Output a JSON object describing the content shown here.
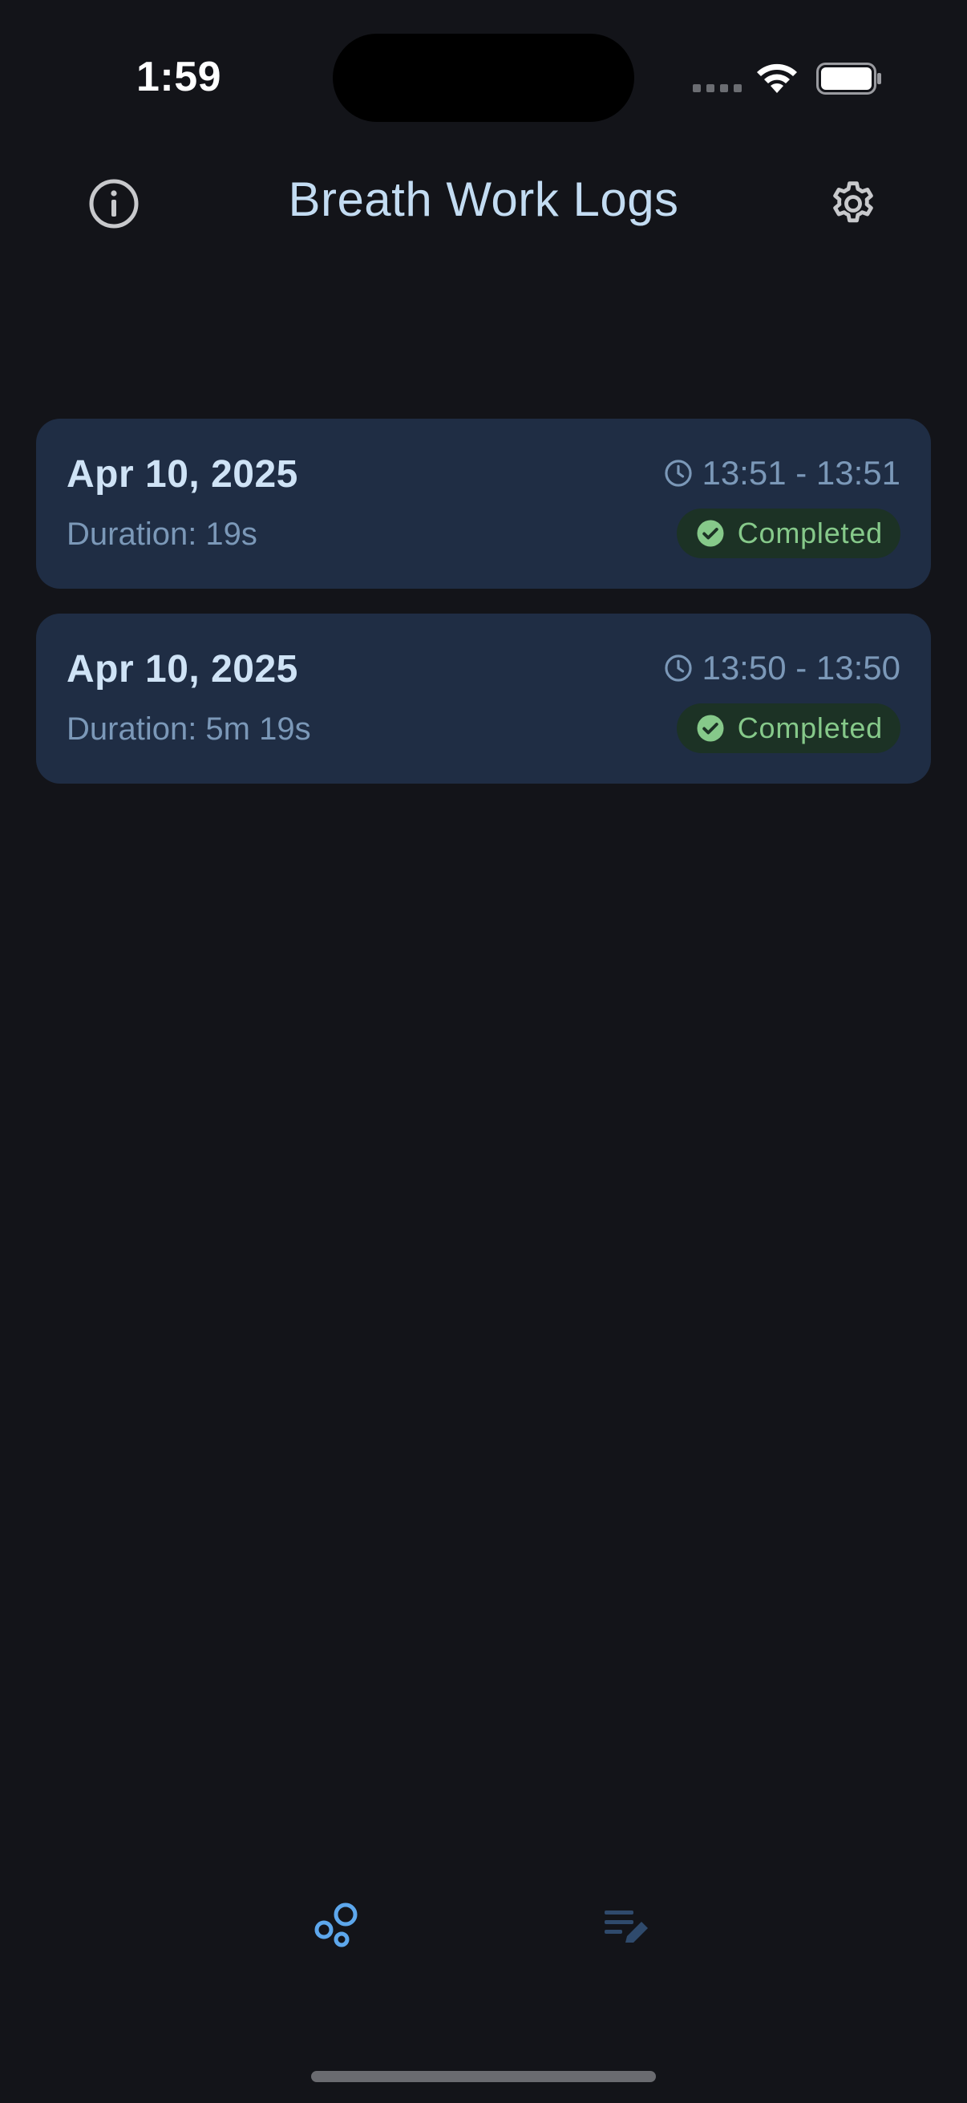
{
  "status_bar": {
    "time": "1:59"
  },
  "header": {
    "title": "Breath Work Logs",
    "info_icon": "info-circle-icon",
    "settings_icon": "gear-icon"
  },
  "logs": [
    {
      "date": "Apr 10, 2025",
      "duration": "Duration: 19s",
      "time_range": "13:51 - 13:51",
      "status": "Completed"
    },
    {
      "date": "Apr 10, 2025",
      "duration": "Duration: 5m 19s",
      "time_range": "13:50 - 13:50",
      "status": "Completed"
    }
  ],
  "bottom_nav": {
    "items": [
      {
        "icon": "bubbles-icon",
        "active": true
      },
      {
        "icon": "notes-edit-icon",
        "active": false
      }
    ]
  },
  "colors": {
    "background": "#131419",
    "card": "#1f2d44",
    "title": "#c3dcf2",
    "muted": "#7b98b8",
    "badge_bg": "#1c3225",
    "badge_text": "#86c98a",
    "nav_active": "#5da7ec",
    "nav_inactive": "#2f4a6c"
  }
}
